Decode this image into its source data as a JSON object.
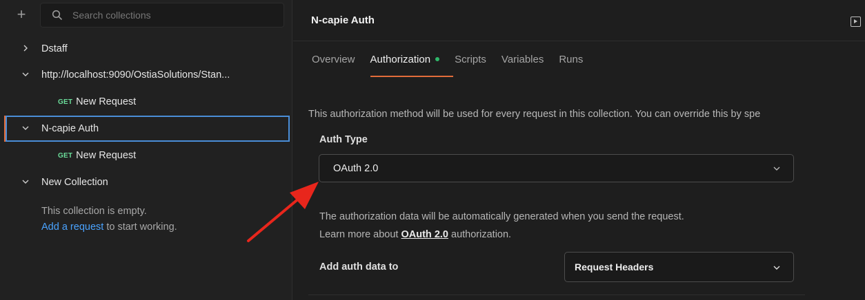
{
  "sidebar": {
    "search_placeholder": "Search collections",
    "tree": [
      {
        "label": "Dstaff",
        "expanded": false
      },
      {
        "label": "http://localhost:9090/OstiaSolutions/Stan...",
        "expanded": true
      },
      {
        "method": "GET",
        "label": "New Request"
      },
      {
        "label": "N-capie Auth",
        "expanded": true,
        "selected": true
      },
      {
        "method": "GET",
        "label": "New Request"
      },
      {
        "label": "New Collection",
        "expanded": true
      }
    ],
    "empty_text": "This collection is empty.",
    "empty_link": "Add a request",
    "empty_suffix": " to start working."
  },
  "main": {
    "title": "N-capie Auth",
    "tabs": [
      "Overview",
      "Authorization",
      "Scripts",
      "Variables",
      "Runs"
    ],
    "description": "This authorization method will be used for every request in this collection. You can override this by spe",
    "auth_type_label": "Auth Type",
    "auth_type_value": "OAuth 2.0",
    "info_line1": "The authorization data will be automatically generated when you send the request.",
    "info_line2_prefix": "Learn more about ",
    "info_line2_link": "OAuth 2.0",
    "info_line2_suffix": " authorization.",
    "add_auth_label": "Add auth data to",
    "add_auth_value": "Request Headers"
  },
  "colors": {
    "accent": "#e26c3a",
    "get_method": "#6bdd9a",
    "link": "#4aa3ff",
    "selection_outline": "#4a8ed8",
    "status_dot": "#2fb86a",
    "annotation_arrow": "#e8261c"
  },
  "icons": [
    "plus-icon",
    "search-icon",
    "chevron-right-icon",
    "chevron-down-icon",
    "run-icon",
    "arrow-annotation"
  ]
}
